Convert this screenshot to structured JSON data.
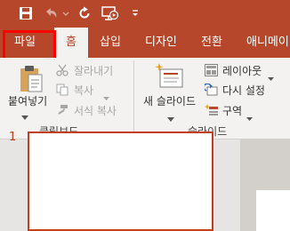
{
  "tabs": {
    "file": "파일",
    "home": "홈",
    "insert": "삽입",
    "design": "디자인",
    "transitions": "전환",
    "animations": "애니메이"
  },
  "clipboard": {
    "paste": "붙여넣기",
    "cut": "잘라내기",
    "copy": "복사",
    "format_painter": "서식 복사",
    "group_label": "클립보드"
  },
  "slides": {
    "new_slide": "새 슬라이드",
    "layout": "레이아웃",
    "reset": "다시 설정",
    "section": "구역",
    "group_label": "슬라이드"
  },
  "thumbnails": {
    "slide_number": "1"
  },
  "colors": {
    "accent": "#b7472a",
    "ribbon_bg": "#f3f2f1",
    "highlight": "#ff0000"
  },
  "icons": [
    "save-icon",
    "undo-icon",
    "redo-icon",
    "present-from-start-icon",
    "customize-qat-icon",
    "paste-icon",
    "cut-icon",
    "copy-icon",
    "format-painter-icon",
    "new-slide-icon",
    "layout-icon",
    "reset-icon",
    "section-icon",
    "dialog-launcher-icon"
  ]
}
